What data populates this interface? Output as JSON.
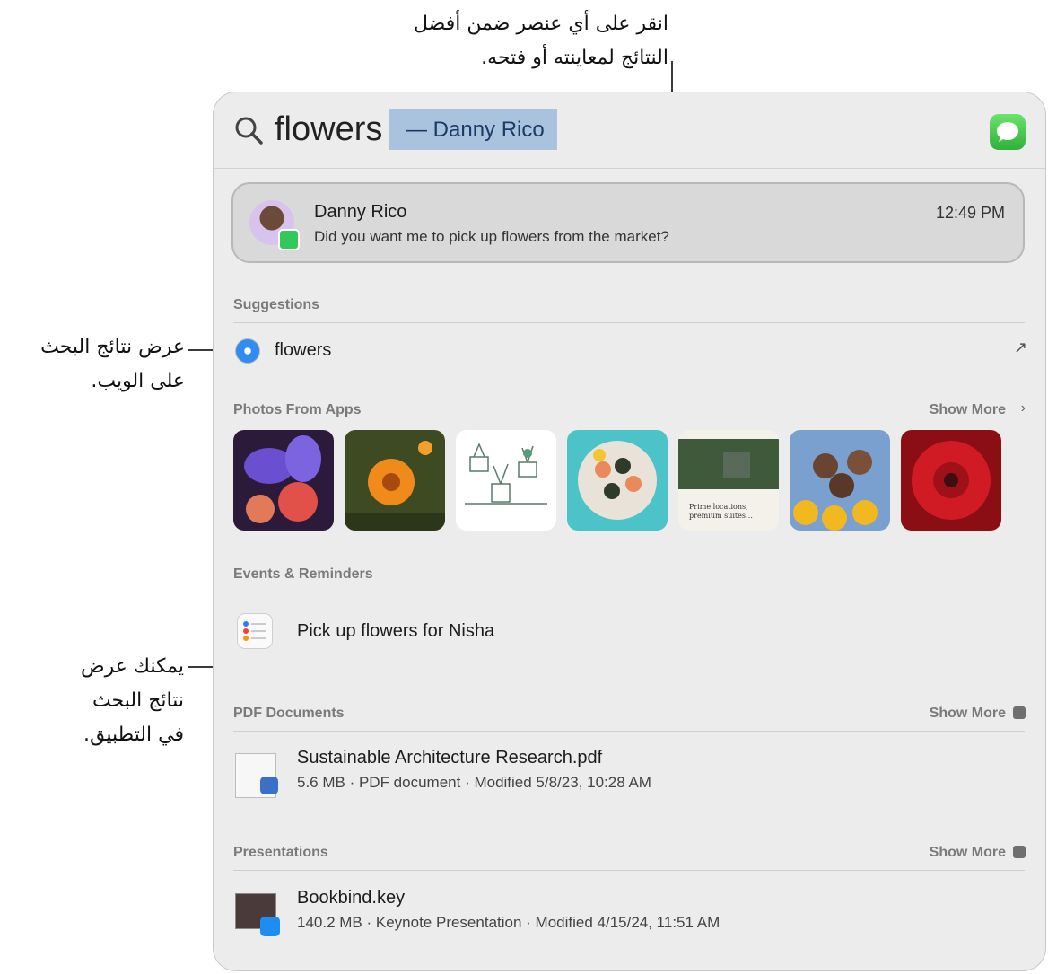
{
  "callouts": {
    "top_line1": "انقر على أي عنصر ضمن أفضل",
    "top_line2": "النتائج لمعاينته أو فتحه.",
    "web_line1": "عرض نتائج البحث",
    "web_line2": "على الويب.",
    "app_line1": "يمكنك عرض",
    "app_line2": "نتائج البحث",
    "app_line3": "في التطبيق."
  },
  "search": {
    "query": "flowers",
    "completion": "— Danny Rico",
    "app_icon": "messages-icon"
  },
  "top_hit": {
    "name": "Danny Rico",
    "message": "Did you want me to pick up flowers from the market?",
    "time": "12:49 PM"
  },
  "suggestions": {
    "title": "Suggestions",
    "item": "flowers",
    "icon": "safari-icon"
  },
  "photos": {
    "title": "Photos From Apps",
    "more": "Show More",
    "items": [
      "iris-bouquet",
      "orange-flower",
      "plant-sketch",
      "sushi-plate",
      "brochure",
      "sunflower-friends",
      "red-gerbera"
    ],
    "overlay_text": "Prime locations, premium suites, private Airstreams, and never"
  },
  "events": {
    "title": "Events & Reminders",
    "item": "Pick up flowers for Nisha"
  },
  "pdf": {
    "title": "PDF Documents",
    "more": "Show More",
    "name": "Sustainable Architecture Research.pdf",
    "meta": "5.6 MB · PDF document · Modified 5/8/23, 10:28 AM"
  },
  "presentations": {
    "title": "Presentations",
    "more": "Show More",
    "name": "Bookbind.key",
    "meta": "140.2 MB · Keynote Presentation · Modified 4/15/24, 11:51 AM"
  }
}
